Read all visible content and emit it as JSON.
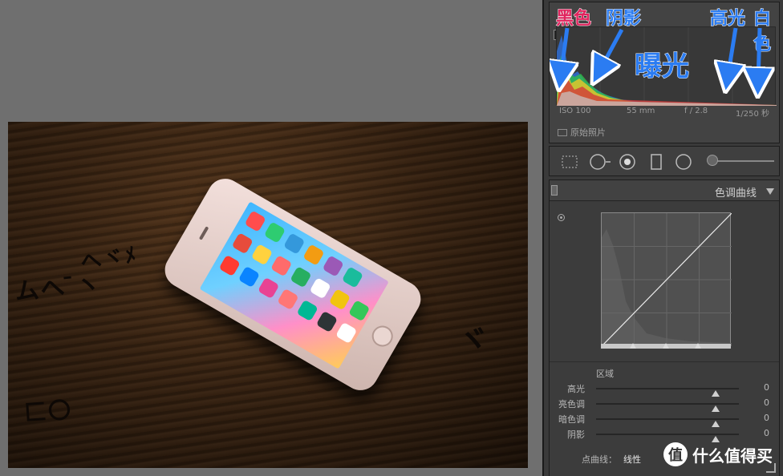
{
  "histogram": {
    "exif": {
      "iso": "ISO 100",
      "focal": "55 mm",
      "aperture": "f / 2.8",
      "shutter": "1/250 秒"
    },
    "original_photo_label": "原始照片",
    "annotations": {
      "black": "黑色",
      "shadow": "阴影",
      "exposure": "曝光",
      "highlight": "高光",
      "white": "白色"
    }
  },
  "tools": [
    "crop-icon",
    "spot-removal-icon",
    "red-eye-icon",
    "graduated-filter-icon",
    "radial-filter-icon",
    "adjustment-brush-icon"
  ],
  "tone_curve": {
    "title": "色调曲线",
    "region_label": "区域",
    "sliders": [
      {
        "label": "高光",
        "value": "0"
      },
      {
        "label": "亮色调",
        "value": "0"
      },
      {
        "label": "暗色调",
        "value": "0"
      },
      {
        "label": "阴影",
        "value": "0"
      }
    ],
    "point_curve_label": "点曲线：",
    "point_curve_value": "线性"
  },
  "watermark": {
    "logo": "值",
    "text": "什么值得买"
  },
  "photo_scrawls": [
    "ムへ ̄ヽ",
    "へヾﾒ",
    "ヾ",
    "匚〇"
  ],
  "colors": {
    "accent_red": "#e0245e",
    "accent_blue": "#2b7cf2",
    "panel": "#3a3a3a"
  }
}
